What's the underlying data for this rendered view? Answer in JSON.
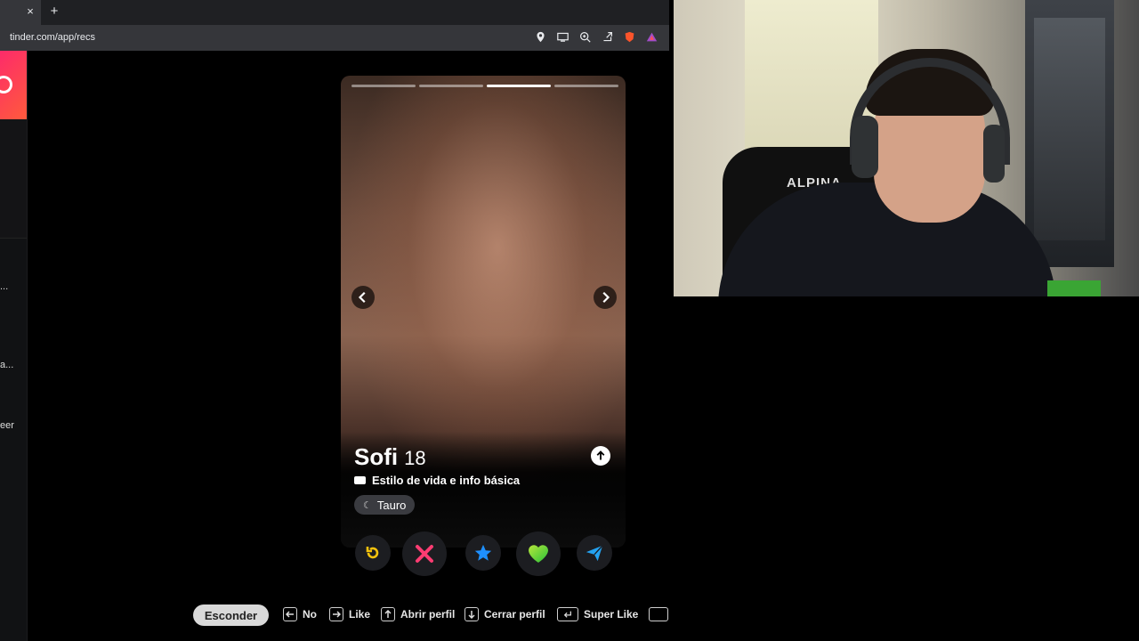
{
  "browser": {
    "tab_close": "×",
    "new_tab": "+",
    "url": "tinder.com/app/recs",
    "toolbar_icons": [
      "location-icon",
      "cast-icon",
      "zoom-icon",
      "share-icon",
      "brave-shield-icon",
      "brave-rewards-icon"
    ]
  },
  "sidebar": {
    "snippets": [
      "...",
      "a...",
      "eer"
    ]
  },
  "card": {
    "photo_count": 4,
    "active_photo": 3,
    "name": "Sofi",
    "age": "18",
    "lifestyle_label": "Estilo de vida e info básica",
    "chips": [
      {
        "icon": "moon-icon",
        "label": "Tauro"
      }
    ]
  },
  "actions": [
    {
      "name": "rewind-button",
      "icon": "rewind-icon",
      "color": "#f4c20d"
    },
    {
      "name": "nope-button",
      "icon": "x-icon",
      "color": "#fe3c72"
    },
    {
      "name": "superlike-button",
      "icon": "star-icon",
      "color": "#1e90ff"
    },
    {
      "name": "like-button",
      "icon": "heart-icon",
      "color": "#62d63b"
    },
    {
      "name": "boost-button",
      "icon": "send-icon",
      "color": "#24a2f0"
    }
  ],
  "shortcuts": {
    "hide_label": "Esconder",
    "no_label": "No",
    "like_label": "Like",
    "open_label": "Abrir perfil",
    "close_label": "Cerrar perfil",
    "superlike_label": "Super Like"
  },
  "webcam": {
    "chair_brand": "ALPINA"
  }
}
